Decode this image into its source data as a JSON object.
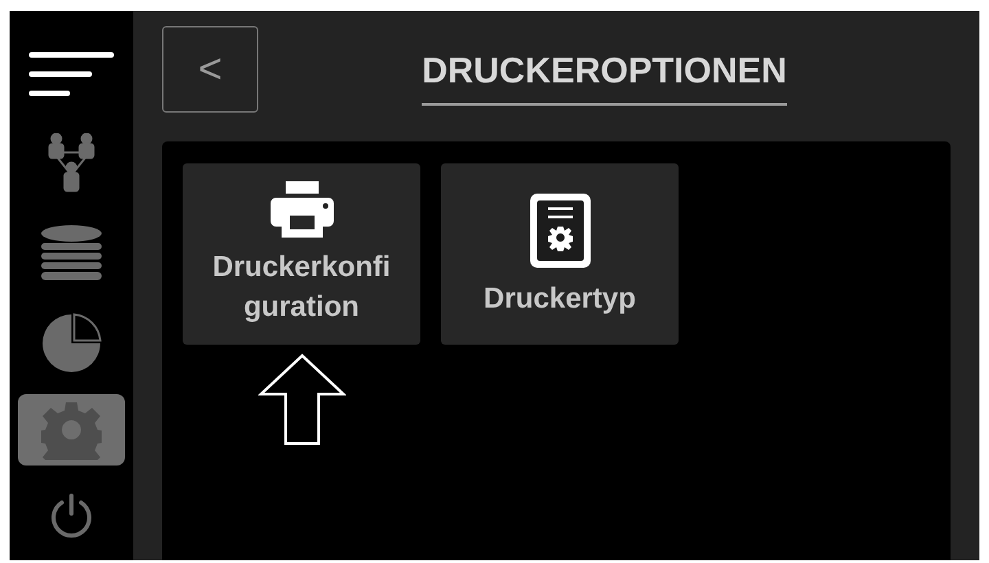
{
  "sidebar": {
    "items": [
      {
        "kind": "menu",
        "selected": false
      },
      {
        "kind": "network",
        "selected": false
      },
      {
        "kind": "database",
        "selected": false
      },
      {
        "kind": "chart",
        "selected": false
      },
      {
        "kind": "settings",
        "selected": true
      },
      {
        "kind": "power",
        "selected": false
      }
    ]
  },
  "header": {
    "back_button": {
      "label": "<"
    },
    "title": "DRUCKEROPTIONEN"
  },
  "tiles": [
    {
      "kind": "printer",
      "label_lines": [
        "Druckerkonfi",
        "guration"
      ]
    },
    {
      "kind": "document-gear",
      "label_lines": [
        "Druckertyp"
      ]
    }
  ],
  "annotation": {
    "kind": "up-arrow"
  }
}
